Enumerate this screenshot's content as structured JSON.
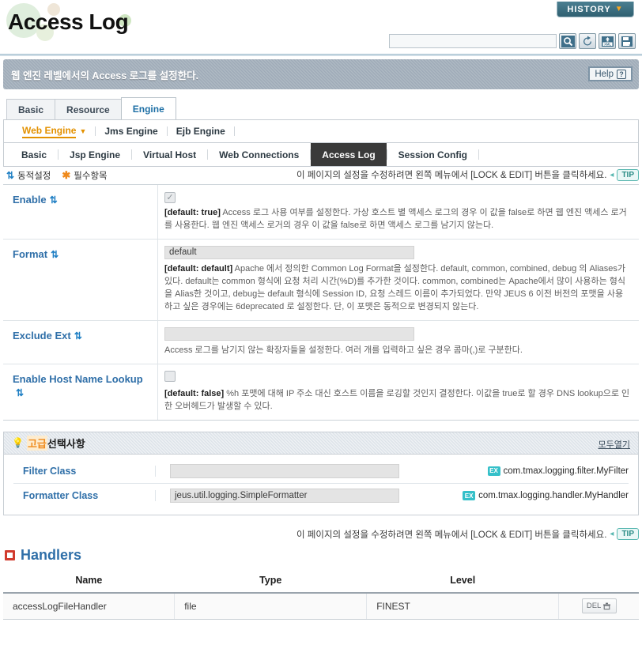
{
  "header": {
    "title": "Access Log",
    "history_button": "HISTORY",
    "search_placeholder": "",
    "search_value": "",
    "tools": [
      {
        "name": "search-icon",
        "label": "Search"
      },
      {
        "name": "refresh-icon",
        "label": "Refresh"
      },
      {
        "name": "xml-export-icon",
        "label": "XML Export"
      },
      {
        "name": "save-icon",
        "label": "Save"
      }
    ]
  },
  "banner": {
    "description": "웹 엔진 레벨에서의 Access 로그를 설정한다.",
    "help_label": "Help",
    "help_icon": "question-mark-icon"
  },
  "tabs_level1": [
    {
      "label": "Basic",
      "active": false
    },
    {
      "label": "Resource",
      "active": false
    },
    {
      "label": "Engine",
      "active": true
    }
  ],
  "tabs_level2": [
    {
      "label": "Web Engine",
      "active": true,
      "has_caret": true
    },
    {
      "label": "Jms Engine",
      "active": false,
      "has_caret": false
    },
    {
      "label": "Ejb Engine",
      "active": false,
      "has_caret": false
    }
  ],
  "tabs_level3": [
    {
      "label": "Basic",
      "active": false
    },
    {
      "label": "Jsp Engine",
      "active": false
    },
    {
      "label": "Virtual Host",
      "active": false
    },
    {
      "label": "Web Connections",
      "active": false
    },
    {
      "label": "Access Log",
      "active": true
    },
    {
      "label": "Session Config",
      "active": false
    }
  ],
  "legend": {
    "dynamic": "동적설정",
    "dynamic_icon": "refresh-icon",
    "required": "필수항목",
    "required_icon": "asterisk-icon",
    "tip_text": "이 페이지의 설정을 수정하려면 왼쪽 메뉴에서 [LOCK & EDIT] 버튼을 클릭하세요.",
    "tip_badge": "TIP"
  },
  "form_rows": [
    {
      "label": "Enable",
      "dynamic": true,
      "control": "checkbox",
      "checked": true,
      "value": "",
      "default_tag": "[default: true]",
      "description": "Access 로그 사용 여부를 설정한다. 가상 호스트 별 액세스 로그의 경우 이 값을 false로 하면 웹 엔진 액세스 로거를 사용한다. 웹 엔진 액세스 로거의 경우 이 값을 false로 하면 액세스 로그를 남기지 않는다."
    },
    {
      "label": "Format",
      "dynamic": true,
      "control": "text",
      "checked": false,
      "value": "default",
      "default_tag": "[default: default]",
      "description": "Apache 에서 정의한 Common Log Format을 설정한다. default, common, combined, debug 의 Aliases가 있다. default는 common 형식에 요청 처리 시간(%D)를 추가한 것이다. common, combined는 Apache에서 많이 사용하는 형식을 Alias한 것이고, debug는 default 형식에 Session ID, 요청 스레드 이름이 추가되었다. 만약 JEUS 6 이전 버전의 포맷을 사용하고 싶은 경우에는 6deprecated 로 설정한다. 단, 이 포맷은 동적으로 변경되지 않는다."
    },
    {
      "label": "Exclude Ext",
      "dynamic": true,
      "control": "text",
      "checked": false,
      "value": "",
      "default_tag": "",
      "description": "Access 로그를 남기지 않는 확장자들을 설정한다. 여러 개를 입력하고 싶은 경우 콤마(,)로 구분한다."
    },
    {
      "label": "Enable Host Name Lookup",
      "dynamic": true,
      "control": "checkbox",
      "checked": false,
      "value": "",
      "default_tag": "[default: false]",
      "description": "%h 포맷에 대해 IP 주소 대신 호스트 이름을 로깅할 것인지 결정한다. 이값을 true로 할 경우 DNS lookup으로 인한 오버헤드가 발생할 수 있다."
    }
  ],
  "advanced": {
    "title_highlight": "고급",
    "title_rest": "선택사항",
    "bulb_icon": "lightbulb-icon",
    "expand_all": "모두열기",
    "rows": [
      {
        "label": "Filter Class",
        "value": "",
        "example_badge": "EX",
        "example": "com.tmax.logging.filter.MyFilter"
      },
      {
        "label": "Formatter Class",
        "value": "jeus.util.logging.SimpleFormatter",
        "example_badge": "EX",
        "example": "com.tmax.logging.handler.MyHandler"
      }
    ]
  },
  "lower_tip": {
    "text": "이 페이지의 설정을 수정하려면 왼쪽 메뉴에서 [LOCK & EDIT] 버튼을 클릭하세요.",
    "badge": "TIP"
  },
  "handlers": {
    "title": "Handlers",
    "title_icon": "square-icon",
    "columns": [
      "Name",
      "Type",
      "Level"
    ],
    "rows": [
      {
        "name": "accessLogFileHandler",
        "type": "file",
        "level": "FINEST",
        "delete_label": "DEL",
        "delete_icon": "trash-icon"
      }
    ]
  },
  "colors": {
    "accent_blue": "#2f6fa8",
    "accent_orange": "#e39100",
    "tip_teal": "#58b7b0",
    "active_tab_dark": "#3a3a3a",
    "banner_gray": "#9fabb8",
    "ex_badge": "#35c0c9",
    "handler_icon_red": "#d13b2e"
  }
}
